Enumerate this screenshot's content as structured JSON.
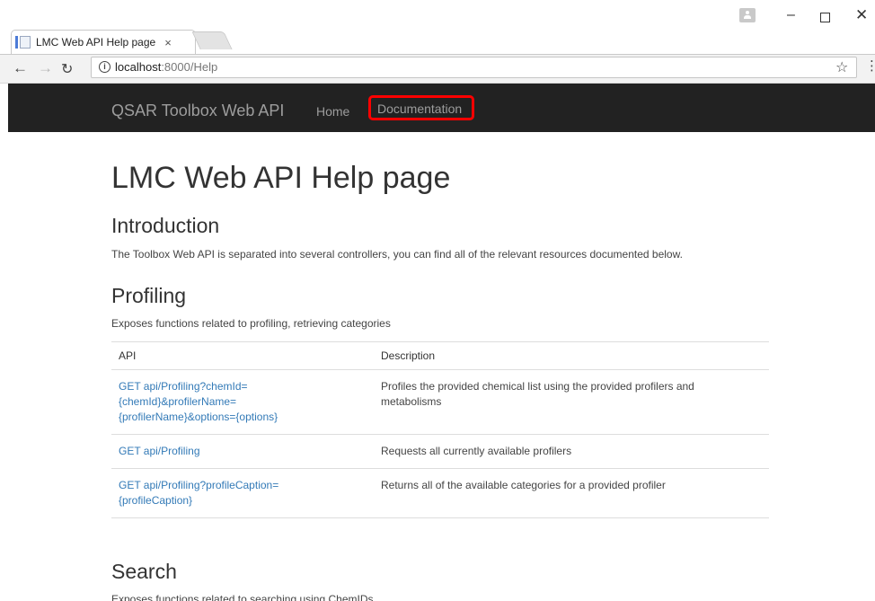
{
  "browser": {
    "tab_title": "LMC Web API Help page",
    "tab_close": "×",
    "url_host": "localhost",
    "url_path": ":8000/Help",
    "info_symbol": "i",
    "window_controls": {
      "minimize": "–",
      "close": "✕"
    },
    "icons": {
      "back": "arrow-left",
      "forward": "arrow-right",
      "reload": "reload",
      "star": "star",
      "menu": "kebab-menu"
    }
  },
  "navbar": {
    "brand": "QSAR Toolbox Web API",
    "items": [
      {
        "label": "Home"
      },
      {
        "label": "Documentation"
      }
    ],
    "highlight_color": "#ff0000",
    "background": "#222222"
  },
  "page": {
    "title": "LMC Web API Help page",
    "intro": {
      "heading": "Introduction",
      "text": "The Toolbox Web API is separated into several controllers, you can find all of the relevant resources documented below."
    },
    "profiling": {
      "heading": "Profiling",
      "text": "Exposes functions related to profiling, retrieving categories",
      "table": {
        "headers": [
          "API",
          "Description"
        ],
        "rows": [
          {
            "api_lines": [
              "GET api/Profiling?chemId=",
              "{chemId}&profilerName=",
              "{profilerName}&options={options}"
            ],
            "description_lines": [
              "Profiles the provided chemical list using the provided profilers and",
              "metabolisms"
            ]
          },
          {
            "api_lines": [
              "GET api/Profiling"
            ],
            "description_lines": [
              "Requests all currently available profilers"
            ]
          },
          {
            "api_lines": [
              "GET api/Profiling?profileCaption=",
              "{profileCaption}"
            ],
            "description_lines": [
              "Returns all of the available categories for a provided profiler"
            ]
          }
        ]
      }
    },
    "search": {
      "heading": "Search",
      "text": "Exposes functions related to searching using ChemIDs"
    }
  },
  "colors": {
    "link": "#337ab7",
    "text": "#333333"
  }
}
